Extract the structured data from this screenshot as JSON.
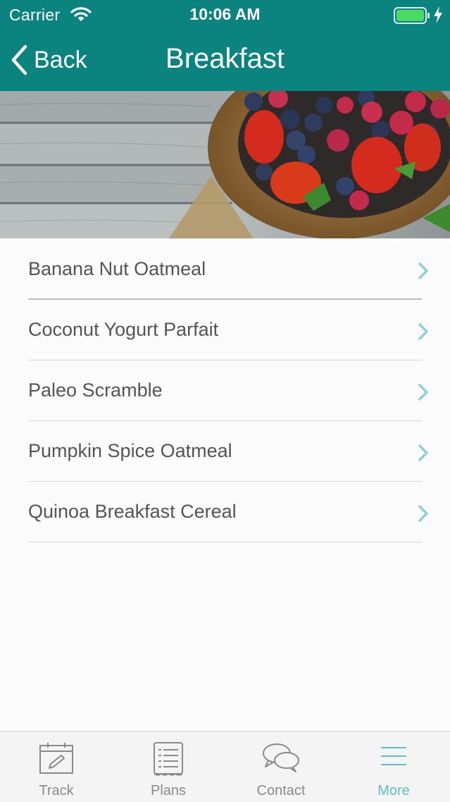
{
  "status_bar": {
    "carrier": "Carrier",
    "time": "10:06 AM"
  },
  "nav": {
    "back_label": "Back",
    "title": "Breakfast"
  },
  "hero": {
    "image": "berries-in-basket-photo"
  },
  "recipes": [
    {
      "label": "Banana Nut Oatmeal"
    },
    {
      "label": "Coconut Yogurt Parfait"
    },
    {
      "label": "Paleo Scramble"
    },
    {
      "label": "Pumpkin Spice Oatmeal"
    },
    {
      "label": "Quinoa Breakfast Cereal"
    }
  ],
  "tabs": [
    {
      "label": "Track",
      "icon": "calendar-pencil-icon",
      "active": false
    },
    {
      "label": "Plans",
      "icon": "document-list-icon",
      "active": false
    },
    {
      "label": "Contact",
      "icon": "chat-bubbles-icon",
      "active": false
    },
    {
      "label": "More",
      "icon": "hamburger-menu-icon",
      "active": true
    }
  ],
  "colors": {
    "header": "#0b8480",
    "accent": "#5fbfc4",
    "list_text": "#555555",
    "chevron": "#8fd0d6"
  }
}
